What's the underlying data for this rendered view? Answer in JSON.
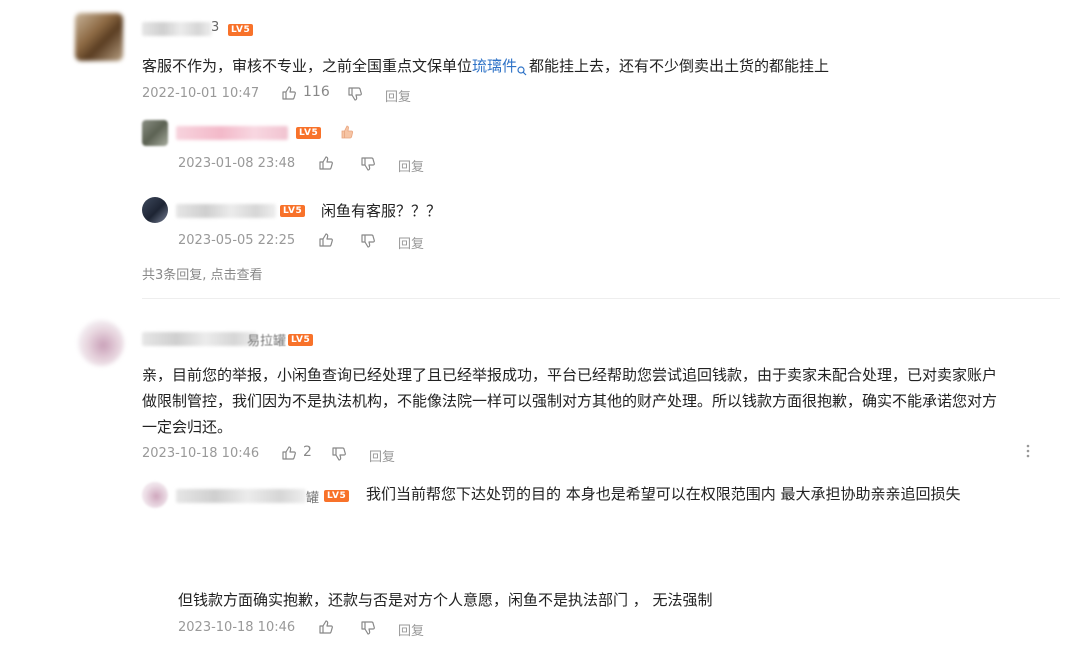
{
  "colors": {
    "link": "#2f73c7",
    "level_badge": "#f8722a",
    "meta": "#999999"
  },
  "level_badge": "LV5",
  "comment1": {
    "username_suffix": "3",
    "text_before_link": "客服不作为，审核不专业，之前全国重点文保单位",
    "link_text": "琉璃件",
    "text_after_link": "都能挂上去，还有不少倒卖出土货的都能挂上",
    "time": "2022-10-01 10:47",
    "likes": "116",
    "reply_label": "回复",
    "replies": [
      {
        "text": "",
        "time": "2023-01-08 23:48",
        "reply_label": "回复"
      },
      {
        "text": "闲鱼有客服？？？",
        "time": "2023-05-05 22:25",
        "reply_label": "回复"
      }
    ],
    "more_replies": "共3条回复, 点击查看"
  },
  "comment2": {
    "username_suffix": "易拉罐",
    "lines": [
      "亲，目前您的举报，小闲鱼查询已经处理了且已经举报成功，平台已经帮助您尝试追回钱款，由于卖家未配合处理，已对卖家账户",
      "做限制管控，我们因为不是执法机构，不能像法院一样可以强制对方其他的财产处理。所以钱款方面很抱歉，确实不能承诺您对方",
      "一定会归还。"
    ],
    "time": "2023-10-18 10:46",
    "likes": "2",
    "reply_label": "回复",
    "more_icon": "more-vertical-icon",
    "reply": {
      "username_suffix": "罐",
      "text": "我们当前帮您下达处罚的目的 本身也是希望可以在权限范围内 最大承担协助亲亲追回损失",
      "continuation": "但钱款方面确实抱歉，还款与否是对方个人意愿，闲鱼不是执法部门 ， 无法强制",
      "time": "2023-10-18 10:46",
      "reply_label": "回复"
    }
  },
  "icons": [
    "like-icon",
    "dislike-icon",
    "search-icon",
    "more-vertical-icon"
  ]
}
